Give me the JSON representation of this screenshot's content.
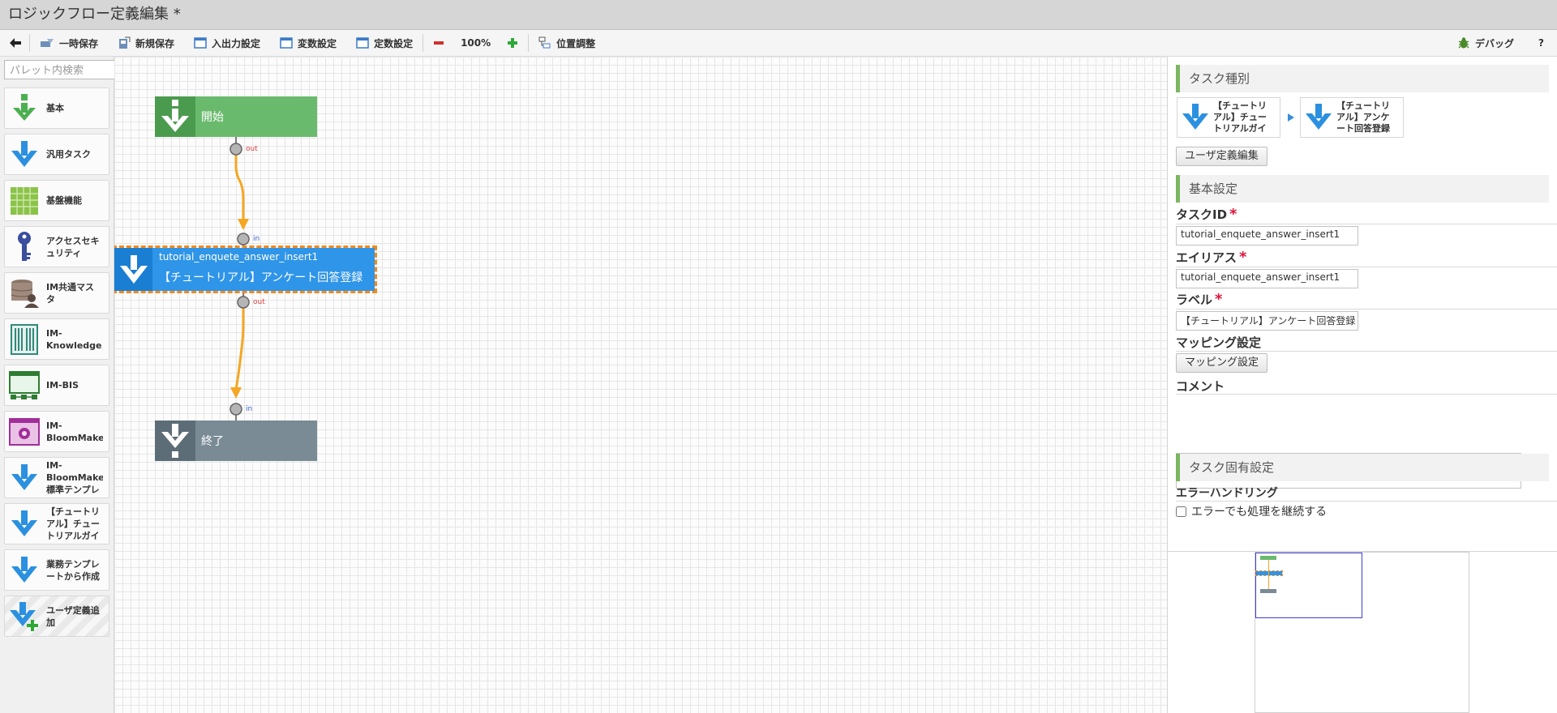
{
  "window": {
    "title": "ロジックフロー定義編集 *"
  },
  "toolbar": {
    "back_icon": "arrow-left-icon",
    "temp_save": "一時保存",
    "new_save": "新規保存",
    "io_settings": "入出力設定",
    "variable_settings": "変数設定",
    "constant_settings": "定数設定",
    "zoom": "100%",
    "position_adjust": "位置調整",
    "debug": "デバッグ",
    "help": "?"
  },
  "palette": {
    "search_placeholder": "パレット内検索",
    "items": [
      {
        "label": "基本",
        "icon": "green-down-arrow-icon"
      },
      {
        "label": "汎用タスク",
        "icon": "blue-down-arrow-icon"
      },
      {
        "label": "基盤機能",
        "icon": "green-grid-icon"
      },
      {
        "label": "アクセスセキュリティ",
        "icon": "key-icon"
      },
      {
        "label": "IM共通マスタ",
        "icon": "database-user-icon"
      },
      {
        "label": "IM-Knowledge",
        "icon": "bookshelf-icon"
      },
      {
        "label": "IM-BIS",
        "icon": "workflow-window-icon"
      },
      {
        "label": "IM-BloomMaker",
        "icon": "bloommaker-icon"
      },
      {
        "label": "IM-BloomMaker標準テンプレ",
        "icon": "blue-down-arrow-icon"
      },
      {
        "label": "【チュートリアル】チュートリアルガイ",
        "icon": "blue-down-arrow-icon"
      },
      {
        "label": "業務テンプレートから作成",
        "icon": "blue-down-arrow-icon"
      },
      {
        "label": "ユーザ定義追加",
        "icon": "blue-down-arrow-plus-icon"
      }
    ]
  },
  "canvas": {
    "start_node": {
      "label": "開始",
      "port_out": "out"
    },
    "task_node": {
      "id": "tutorial_enquete_answer_insert1",
      "label": "【チュートリアル】アンケート回答登録",
      "port_in": "in",
      "port_out": "out"
    },
    "end_node": {
      "label": "終了",
      "port_in": "in"
    },
    "colors": {
      "start": "#6aba6e",
      "task": "#2f95e8",
      "end": "#7a8b95",
      "connector": "#f5a623",
      "selection": "#f08a1e"
    }
  },
  "properties": {
    "task_type": {
      "heading": "タスク種別",
      "breadcrumb": [
        {
          "label": "【チュートリアル】チュートリアルガイ"
        },
        {
          "label": "【チュートリアル】アンケート回答登録"
        }
      ],
      "user_def_edit_button": "ユーザ定義編集"
    },
    "basic": {
      "heading": "基本設定",
      "task_id_label": "タスクID",
      "task_id_value": "tutorial_enquete_answer_insert1",
      "alias_label": "エイリアス",
      "alias_value": "tutorial_enquete_answer_insert1",
      "label_label": "ラベル",
      "label_value": "【チュートリアル】アンケート回答登録",
      "mapping_label": "マッピング設定",
      "mapping_button": "マッピング設定",
      "comment_label": "コメント",
      "comment_value": "",
      "required_mark": "*"
    },
    "specific": {
      "heading": "タスク固有設定",
      "error_handling_label": "エラーハンドリング",
      "continue_on_error_label": "エラーでも処理を継続する",
      "continue_on_error_checked": false
    }
  }
}
